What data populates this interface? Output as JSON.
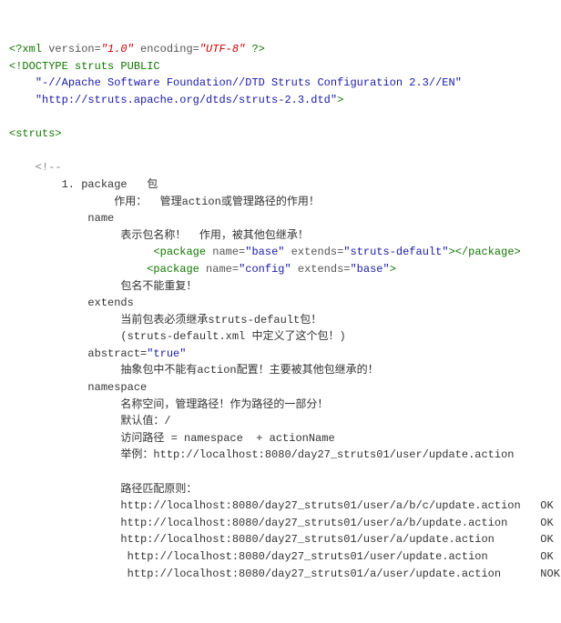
{
  "xml_decl": {
    "open": "<?xml ",
    "version_attr": "version=",
    "version_val": "\"1.0\"",
    "encoding_attr": " encoding=",
    "encoding_val": "\"UTF-8\"",
    "close": " ?>"
  },
  "doctype": {
    "line1": "<!DOCTYPE struts PUBLIC",
    "line2_indent": "    ",
    "line2_val": "\"-//Apache Software Foundation//DTD Struts Configuration 2.3//EN\"",
    "line3_indent": "    ",
    "line3_val": "\"http://struts.apache.org/dtds/struts-2.3.dtd\"",
    "line3_close": ">"
  },
  "struts_open": "<struts>",
  "comment_open": "    <!--",
  "lines": {
    "l1": "        1. package   包",
    "l2": "                作用：  管理action或管理路径的作用！",
    "l3": "            name",
    "l4": "                 表示包名称！  作用，被其他包继承！",
    "l5a_indent": "                      ",
    "l5a_open": "<package ",
    "l5a_name_attr": "name=",
    "l5a_name_val": "\"base\"",
    "l5a_extends_attr": " extends=",
    "l5a_extends_val": "\"struts-default\"",
    "l5a_close1": ">",
    "l5a_close2": "</package>",
    "l5b_indent": "                     ",
    "l5b_open": "<package ",
    "l5b_name_attr": "name=",
    "l5b_name_val": "\"config\"",
    "l5b_extends_attr": " extends=",
    "l5b_extends_val": "\"base\"",
    "l5b_close": ">",
    "l6": "                 包名不能重复！",
    "l7": "            extends",
    "l8": "                 当前包表必须继承struts-default包！",
    "l9": "                 (struts-default.xml 中定义了这个包！)",
    "l10a": "            abstract=",
    "l10b": "\"true\"",
    "l11": "                 抽象包中不能有action配置！主要被其他包继承的！",
    "l12": "            namespace",
    "l13": "                 名称空间，管理路径！作为路径的一部分！",
    "l14": "                 默认值：/",
    "l15": "                 访问路径 = namespace  + actionName",
    "l16": "                 举例：http://localhost:8080/day27_struts01/user/update.action",
    "l17": "",
    "l18": "                 路径匹配原则：",
    "l19": "                 http://localhost:8080/day27_struts01/user/a/b/c/update.action   OK",
    "l20": "                 http://localhost:8080/day27_struts01/user/a/b/update.action     OK",
    "l21": "                 http://localhost:8080/day27_struts01/user/a/update.action       OK",
    "l22": "                  http://localhost:8080/day27_struts01/user/update.action        OK",
    "l23": "                  http://localhost:8080/day27_struts01/a/user/update.action      NOK"
  }
}
